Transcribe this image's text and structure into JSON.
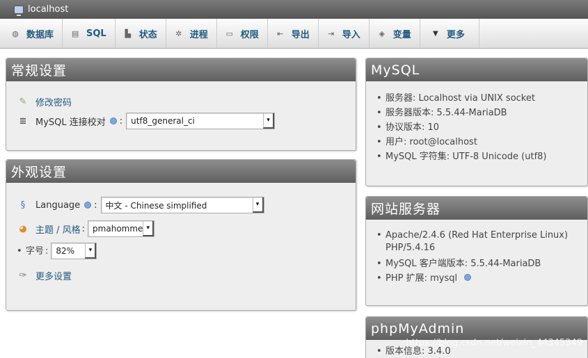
{
  "window": {
    "title": "localhost"
  },
  "tabs": [
    {
      "label": "数据库",
      "icon": "database-icon",
      "glyph": "◍"
    },
    {
      "label": "SQL",
      "icon": "sql-icon",
      "glyph": "▤"
    },
    {
      "label": "状态",
      "icon": "status-icon",
      "glyph": "▙"
    },
    {
      "label": "进程",
      "icon": "process-icon",
      "glyph": "✲"
    },
    {
      "label": "权限",
      "icon": "privileges-icon",
      "glyph": "▭"
    },
    {
      "label": "导出",
      "icon": "export-icon",
      "glyph": "⇤"
    },
    {
      "label": "导入",
      "icon": "import-icon",
      "glyph": "⇥"
    },
    {
      "label": "变量",
      "icon": "variables-icon",
      "glyph": "◈"
    },
    {
      "label": "更多",
      "icon": "more-icon",
      "glyph": "▼"
    }
  ],
  "general": {
    "title": "常规设置",
    "change_password": "修改密码",
    "collation_label": "MySQL 连接校对",
    "colon": ":",
    "collation_value": "utf8_general_ci"
  },
  "appearance": {
    "title": "外观设置",
    "language_label": "Language",
    "colon": ":",
    "language_value": "中文 - Chinese simplified",
    "theme_label": "主题 / 风格",
    "theme_colon": ":",
    "theme_value": "pmahomme",
    "font_label": "字号",
    "font_colon": ":",
    "font_value": "82%",
    "more_settings": "更多设置"
  },
  "mysql": {
    "title": "MySQL",
    "items": [
      "服务器: Localhost via UNIX socket",
      "服务器版本: 5.5.44-MariaDB",
      "协议版本: 10",
      "用户: root@localhost",
      "MySQL 字符集: UTF-8 Unicode (utf8)"
    ]
  },
  "webserver": {
    "title": "网站服务器",
    "items": [
      "Apache/2.4.6 (Red Hat Enterprise Linux) PHP/5.4.16",
      "MySQL 客户端版本: 5.5.44-MariaDB",
      "PHP 扩展: mysql"
    ]
  },
  "phpmyadmin": {
    "title": "phpMyAdmin",
    "items": [
      "版本信息: 3.4.0"
    ]
  },
  "watermark": "https://blog.csdn.net/weixin_44345349"
}
